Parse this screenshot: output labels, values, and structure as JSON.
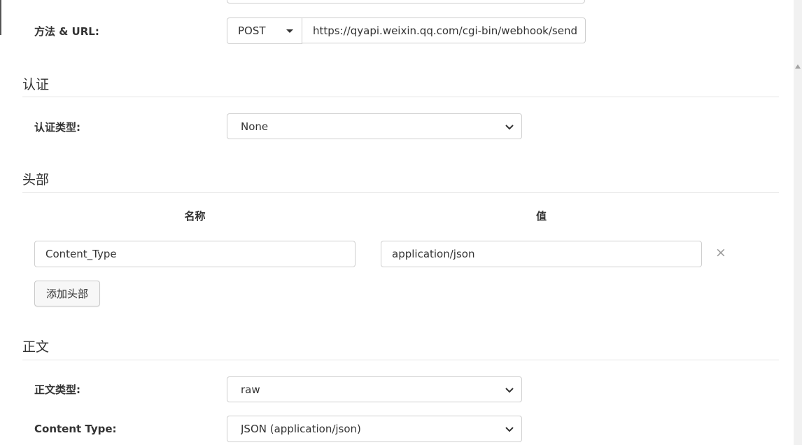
{
  "request": {
    "method_url_label": "方法 & URL:",
    "method": "POST",
    "url": "https://qyapi.weixin.qq.com/cgi-bin/webhook/send?ke"
  },
  "auth": {
    "section_title": "认证",
    "type_label": "认证类型:",
    "type_value": "None"
  },
  "headers": {
    "section_title": "头部",
    "name_column": "名称",
    "value_column": "值",
    "rows": [
      {
        "name": "Content_Type",
        "value": "application/json"
      }
    ],
    "add_button": "添加头部"
  },
  "body": {
    "section_title": "正文",
    "type_label": "正文类型:",
    "type_value": "raw",
    "content_type_label": "Content Type:",
    "content_type_value": "JSON (application/json)"
  },
  "icons": {
    "chevron": "chevron-down-icon",
    "caret": "caret-down-icon",
    "remove": "close-icon"
  }
}
